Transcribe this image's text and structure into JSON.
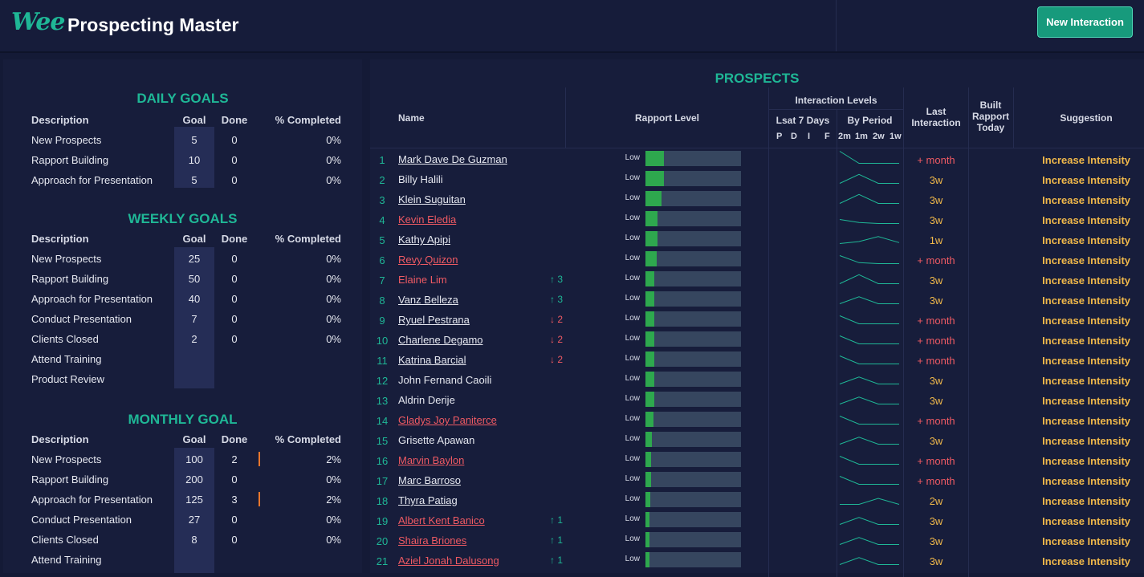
{
  "header": {
    "logo": "Wee",
    "title": "Prospecting Master",
    "new_interaction_label": "New Interaction"
  },
  "daily": {
    "title": "DAILY GOALS",
    "headers": [
      "Description",
      "Goal",
      "Done",
      "% Completed"
    ],
    "rows": [
      {
        "desc": "New Prospects",
        "goal": "5",
        "done": "0",
        "pct": "0%"
      },
      {
        "desc": "Rapport Building",
        "goal": "10",
        "done": "0",
        "pct": "0%"
      },
      {
        "desc": "Approach for Presentation",
        "goal": "5",
        "done": "0",
        "pct": "0%"
      }
    ]
  },
  "weekly": {
    "title": "WEEKLY GOALS",
    "headers": [
      "Description",
      "Goal",
      "Done",
      "% Completed"
    ],
    "rows": [
      {
        "desc": "New Prospects",
        "goal": "25",
        "done": "0",
        "pct": "0%"
      },
      {
        "desc": "Rapport Building",
        "goal": "50",
        "done": "0",
        "pct": "0%"
      },
      {
        "desc": "Approach for Presentation",
        "goal": "40",
        "done": "0",
        "pct": "0%"
      },
      {
        "desc": "Conduct Presentation",
        "goal": "7",
        "done": "0",
        "pct": "0%"
      },
      {
        "desc": "Clients Closed",
        "goal": "2",
        "done": "0",
        "pct": "0%"
      },
      {
        "desc": "Attend Training",
        "goal": "",
        "done": "",
        "pct": ""
      },
      {
        "desc": "Product Review",
        "goal": "",
        "done": "",
        "pct": ""
      }
    ]
  },
  "monthly": {
    "title": "MONTHLY GOAL",
    "headers": [
      "Description",
      "Goal",
      "Done",
      "% Completed"
    ],
    "rows": [
      {
        "desc": "New Prospects",
        "goal": "100",
        "done": "2",
        "pct": "2%"
      },
      {
        "desc": "Rapport Building",
        "goal": "200",
        "done": "0",
        "pct": "0%"
      },
      {
        "desc": "Approach for Presentation",
        "goal": "125",
        "done": "3",
        "pct": "2%"
      },
      {
        "desc": "Conduct Presentation",
        "goal": "27",
        "done": "0",
        "pct": "0%"
      },
      {
        "desc": "Clients Closed",
        "goal": "8",
        "done": "0",
        "pct": "0%"
      },
      {
        "desc": "Attend Training",
        "goal": "",
        "done": "",
        "pct": ""
      }
    ]
  },
  "prospects": {
    "title": "PROSPECTS",
    "headers": {
      "name": "Name",
      "rapport": "Rapport Level",
      "interaction_levels": "Interaction Levels",
      "last7": "Lsat 7 Days",
      "by_period": "By Period",
      "last7_cols": [
        "P",
        "D",
        "I",
        "F"
      ],
      "period_cols": [
        "2m",
        "1m",
        "2w",
        "1w"
      ],
      "last_interaction": "Last Interaction",
      "built_rapport": "Built Rapport Today",
      "suggestion": "Suggestion"
    },
    "colors": {
      "accent": "#1fb796",
      "red": "#ef5a63",
      "gold": "#f0b84a",
      "bar_fill": "#2ea84e",
      "bar_track": "#36465f"
    },
    "rows": [
      {
        "num": "1",
        "name": "Mark Dave De Guzman",
        "link": true,
        "red": false,
        "trend": "",
        "rapport_label": "Low",
        "rapport_level": 0.19,
        "spark": [
          0.1,
          0.7,
          0.7,
          0.7
        ],
        "last": "+ month",
        "sug": "Increase Intensity"
      },
      {
        "num": "2",
        "name": "Billy Halili",
        "link": false,
        "red": false,
        "trend": "",
        "rapport_label": "Low",
        "rapport_level": 0.19,
        "spark": [
          0.7,
          0.25,
          0.7,
          0.7
        ],
        "last": "3w",
        "sug": "Increase Intensity"
      },
      {
        "num": "3",
        "name": "Klein Suguitan",
        "link": true,
        "red": false,
        "trend": "",
        "rapport_label": "Low",
        "rapport_level": 0.17,
        "spark": [
          0.7,
          0.25,
          0.7,
          0.7
        ],
        "last": "3w",
        "sug": "Increase Intensity"
      },
      {
        "num": "4",
        "name": "Kevin Eledia",
        "link": true,
        "red": true,
        "trend": "",
        "rapport_label": "Low",
        "rapport_level": 0.13,
        "spark": [
          0.5,
          0.65,
          0.7,
          0.7
        ],
        "last": "3w",
        "sug": "Increase Intensity"
      },
      {
        "num": "5",
        "name": "Kathy Apipi",
        "link": true,
        "red": false,
        "trend": "",
        "rapport_label": "Low",
        "rapport_level": 0.13,
        "spark": [
          0.7,
          0.6,
          0.35,
          0.65
        ],
        "last": "1w",
        "sug": "Increase Intensity"
      },
      {
        "num": "6",
        "name": "Revy Quizon",
        "link": true,
        "red": true,
        "trend": "",
        "rapport_label": "Low",
        "rapport_level": 0.12,
        "spark": [
          0.3,
          0.65,
          0.7,
          0.7
        ],
        "last": "+ month",
        "sug": "Increase Intensity"
      },
      {
        "num": "7",
        "name": "Elaine Lim",
        "link": false,
        "red": true,
        "trend": "↑ 3",
        "trend_dir": "up",
        "rapport_label": "Low",
        "rapport_level": 0.09,
        "spark": [
          0.7,
          0.25,
          0.7,
          0.7
        ],
        "last": "3w",
        "sug": "Increase Intensity"
      },
      {
        "num": "8",
        "name": "Vanz Belleza",
        "link": true,
        "red": false,
        "trend": "↑ 3",
        "trend_dir": "up",
        "rapport_label": "Low",
        "rapport_level": 0.09,
        "spark": [
          0.7,
          0.35,
          0.7,
          0.7
        ],
        "last": "3w",
        "sug": "Increase Intensity"
      },
      {
        "num": "9",
        "name": "Ryuel Pestrana",
        "link": true,
        "red": false,
        "trend": "↓ 2",
        "trend_dir": "down",
        "rapport_label": "Low",
        "rapport_level": 0.09,
        "spark": [
          0.3,
          0.7,
          0.7,
          0.7
        ],
        "last": "+ month",
        "sug": "Increase Intensity"
      },
      {
        "num": "10",
        "name": "Charlene Degamo",
        "link": true,
        "red": false,
        "trend": "↓ 2",
        "trend_dir": "down",
        "rapport_label": "Low",
        "rapport_level": 0.09,
        "spark": [
          0.3,
          0.7,
          0.7,
          0.7
        ],
        "last": "+ month",
        "sug": "Increase Intensity"
      },
      {
        "num": "11",
        "name": "Katrina Barcial",
        "link": true,
        "red": false,
        "trend": "↓ 2",
        "trend_dir": "down",
        "rapport_label": "Low",
        "rapport_level": 0.09,
        "spark": [
          0.3,
          0.7,
          0.7,
          0.7
        ],
        "last": "+ month",
        "sug": "Increase Intensity"
      },
      {
        "num": "12",
        "name": "John Fernand Caoili",
        "link": false,
        "red": false,
        "trend": "",
        "rapport_label": "Low",
        "rapport_level": 0.09,
        "spark": [
          0.7,
          0.35,
          0.7,
          0.7
        ],
        "last": "3w",
        "sug": "Increase Intensity"
      },
      {
        "num": "13",
        "name": "Aldrin Derije",
        "link": false,
        "red": false,
        "trend": "",
        "rapport_label": "Low",
        "rapport_level": 0.09,
        "spark": [
          0.7,
          0.35,
          0.7,
          0.7
        ],
        "last": "3w",
        "sug": "Increase Intensity"
      },
      {
        "num": "14",
        "name": "Gladys Joy Paniterce",
        "link": true,
        "red": true,
        "trend": "",
        "rapport_label": "Low",
        "rapport_level": 0.08,
        "spark": [
          0.3,
          0.7,
          0.7,
          0.7
        ],
        "last": "+ month",
        "sug": "Increase Intensity"
      },
      {
        "num": "15",
        "name": "Grisette Apawan",
        "link": false,
        "red": false,
        "trend": "",
        "rapport_label": "Low",
        "rapport_level": 0.07,
        "spark": [
          0.7,
          0.35,
          0.7,
          0.7
        ],
        "last": "3w",
        "sug": "Increase Intensity"
      },
      {
        "num": "16",
        "name": "Marvin Baylon",
        "link": true,
        "red": true,
        "trend": "",
        "rapport_label": "Low",
        "rapport_level": 0.06,
        "spark": [
          0.3,
          0.7,
          0.7,
          0.7
        ],
        "last": "+ month",
        "sug": "Increase Intensity"
      },
      {
        "num": "17",
        "name": "Marc Barroso",
        "link": true,
        "red": false,
        "trend": "",
        "rapport_label": "Low",
        "rapport_level": 0.06,
        "spark": [
          0.3,
          0.7,
          0.7,
          0.7
        ],
        "last": "+ month",
        "sug": "Increase Intensity"
      },
      {
        "num": "18",
        "name": "Thyra Patiag",
        "link": true,
        "red": false,
        "trend": "",
        "rapport_label": "Low",
        "rapport_level": 0.05,
        "spark": [
          0.7,
          0.7,
          0.4,
          0.7
        ],
        "last": "2w",
        "sug": "Increase Intensity"
      },
      {
        "num": "19",
        "name": "Albert Kent Banico",
        "link": true,
        "red": true,
        "trend": "↑ 1",
        "trend_dir": "up",
        "rapport_label": "Low",
        "rapport_level": 0.04,
        "spark": [
          0.7,
          0.35,
          0.7,
          0.7
        ],
        "last": "3w",
        "sug": "Increase Intensity"
      },
      {
        "num": "20",
        "name": "Shaira Briones",
        "link": true,
        "red": true,
        "trend": "↑ 1",
        "trend_dir": "up",
        "rapport_label": "Low",
        "rapport_level": 0.04,
        "spark": [
          0.7,
          0.35,
          0.7,
          0.7
        ],
        "last": "3w",
        "sug": "Increase Intensity"
      },
      {
        "num": "21",
        "name": "Aziel Jonah Dalusong",
        "link": true,
        "red": true,
        "trend": "↑ 1",
        "trend_dir": "up",
        "rapport_label": "Low",
        "rapport_level": 0.04,
        "spark": [
          0.7,
          0.35,
          0.7,
          0.7
        ],
        "last": "3w",
        "sug": "Increase Intensity"
      }
    ]
  }
}
